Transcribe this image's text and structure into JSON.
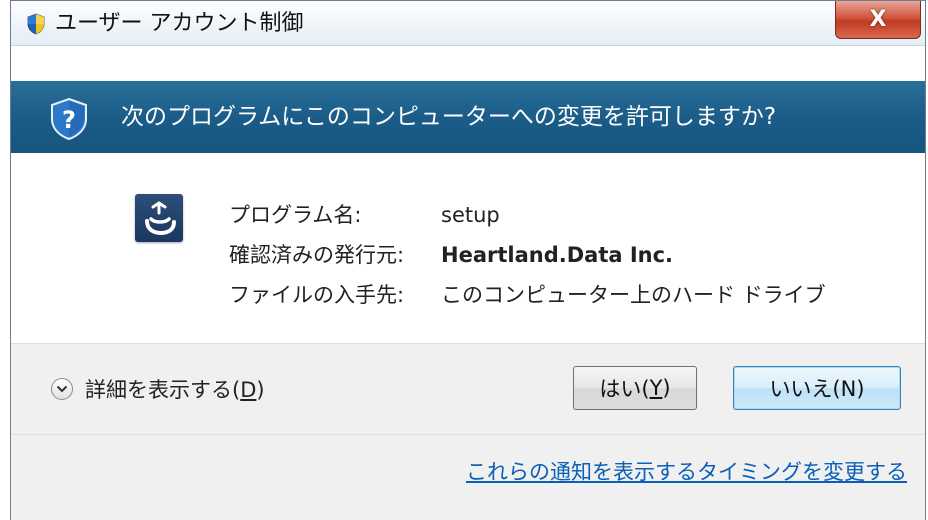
{
  "window": {
    "title": "ユーザー アカウント制御",
    "close_label": "X"
  },
  "banner": {
    "question": "次のプログラムにこのコンピューターへの変更を許可しますか?"
  },
  "program_info": {
    "rows": [
      {
        "label": "プログラム名:",
        "value": "setup"
      },
      {
        "label": "確認済みの発行元:",
        "value": "Heartland.Data Inc."
      },
      {
        "label": "ファイルの入手先:",
        "value": "このコンピューター上のハード ドライブ"
      }
    ]
  },
  "details": {
    "label_prefix": "詳細を表示する(",
    "accesskey": "D",
    "label_suffix": ")"
  },
  "buttons": {
    "yes_prefix": "はい(",
    "yes_key": "Y",
    "yes_suffix": ")",
    "no_label": "いいえ(N)"
  },
  "notification_link": "これらの通知を表示するタイミングを変更する",
  "colors": {
    "banner": "#1b5d88",
    "link": "#0a5fb8",
    "close": "#c03a22"
  }
}
